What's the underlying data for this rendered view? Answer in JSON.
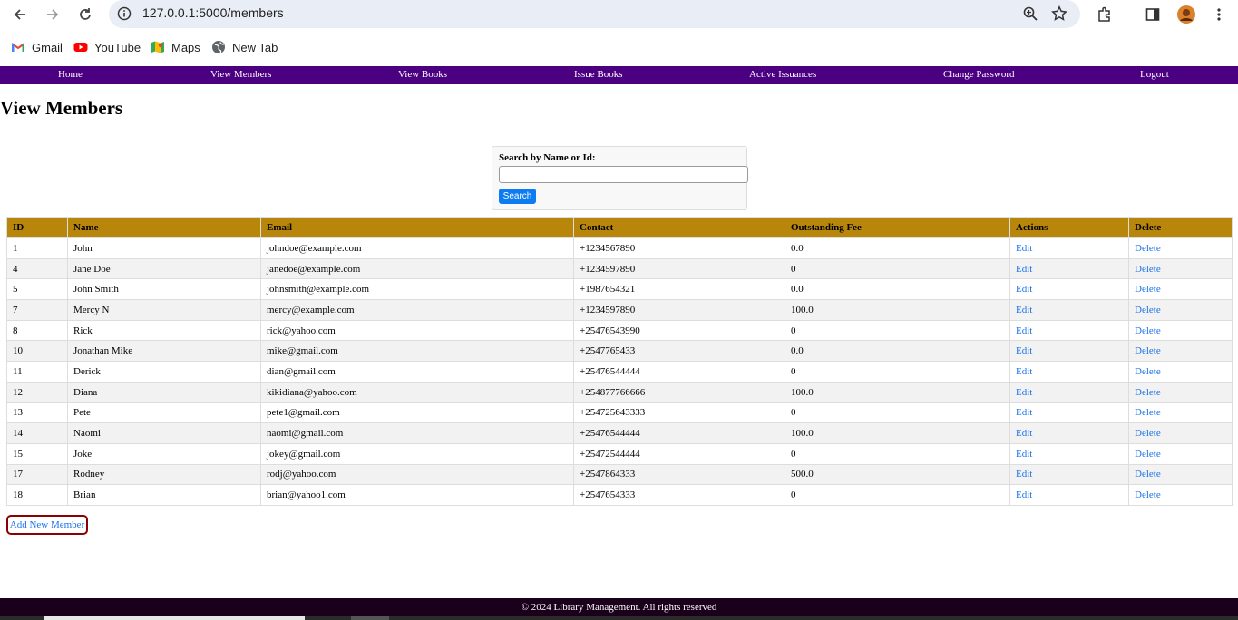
{
  "browser": {
    "url": "127.0.0.1:5000/members",
    "bookmarks": [
      {
        "label": "Gmail",
        "icon": "gmail-icon"
      },
      {
        "label": "YouTube",
        "icon": "youtube-icon"
      },
      {
        "label": "Maps",
        "icon": "maps-icon"
      },
      {
        "label": "New Tab",
        "icon": "globe-icon"
      }
    ]
  },
  "nav": {
    "items": [
      "Home",
      "View Members",
      "View Books",
      "Issue Books",
      "Active Issuances",
      "Change Password",
      "Logout"
    ],
    "background": "#4b0082"
  },
  "page": {
    "title": "View Members"
  },
  "search": {
    "label": "Search by Name or Id:",
    "value": "",
    "button": "Search"
  },
  "table": {
    "headers": [
      "ID",
      "Name",
      "Email",
      "Contact",
      "Outstanding Fee",
      "Actions",
      "Delete"
    ],
    "header_color": "#b8860b",
    "rows": [
      {
        "id": "1",
        "name": "John",
        "email": "johndoe@example.com",
        "contact": "+1234567890",
        "fee": "0.0",
        "action": "Edit",
        "delete": "Delete"
      },
      {
        "id": "4",
        "name": "Jane Doe",
        "email": "janedoe@example.com",
        "contact": "+1234597890",
        "fee": "0",
        "action": "Edit",
        "delete": "Delete"
      },
      {
        "id": "5",
        "name": "John Smith",
        "email": "johnsmith@example.com",
        "contact": "+1987654321",
        "fee": "0.0",
        "action": "Edit",
        "delete": "Delete"
      },
      {
        "id": "7",
        "name": "Mercy N",
        "email": "mercy@example.com",
        "contact": "+1234597890",
        "fee": "100.0",
        "action": "Edit",
        "delete": "Delete"
      },
      {
        "id": "8",
        "name": "Rick",
        "email": "rick@yahoo.com",
        "contact": "+25476543990",
        "fee": "0",
        "action": "Edit",
        "delete": "Delete"
      },
      {
        "id": "10",
        "name": "Jonathan Mike",
        "email": "mike@gmail.com",
        "contact": "+2547765433",
        "fee": "0.0",
        "action": "Edit",
        "delete": "Delete"
      },
      {
        "id": "11",
        "name": "Derick",
        "email": "dian@gmail.com",
        "contact": "+25476544444",
        "fee": "0",
        "action": "Edit",
        "delete": "Delete"
      },
      {
        "id": "12",
        "name": "Diana",
        "email": "kikidiana@yahoo.com",
        "contact": "+254877766666",
        "fee": "100.0",
        "action": "Edit",
        "delete": "Delete"
      },
      {
        "id": "13",
        "name": "Pete",
        "email": "pete1@gmail.com",
        "contact": "+254725643333",
        "fee": "0",
        "action": "Edit",
        "delete": "Delete"
      },
      {
        "id": "14",
        "name": "Naomi",
        "email": "naomi@gmail.com",
        "contact": "+25476544444",
        "fee": "100.0",
        "action": "Edit",
        "delete": "Delete"
      },
      {
        "id": "15",
        "name": "Joke",
        "email": "jokey@gmail.com",
        "contact": "+25472544444",
        "fee": "0",
        "action": "Edit",
        "delete": "Delete"
      },
      {
        "id": "17",
        "name": "Rodney",
        "email": "rodj@yahoo.com",
        "contact": "+2547864333",
        "fee": "500.0",
        "action": "Edit",
        "delete": "Delete"
      },
      {
        "id": "18",
        "name": "Brian",
        "email": "brian@yahoo1.com",
        "contact": "+2547654333",
        "fee": "0",
        "action": "Edit",
        "delete": "Delete"
      }
    ]
  },
  "add_member": {
    "label": "Add New Member"
  },
  "footer": {
    "text": "© 2024 Library Management. All rights reserved"
  }
}
